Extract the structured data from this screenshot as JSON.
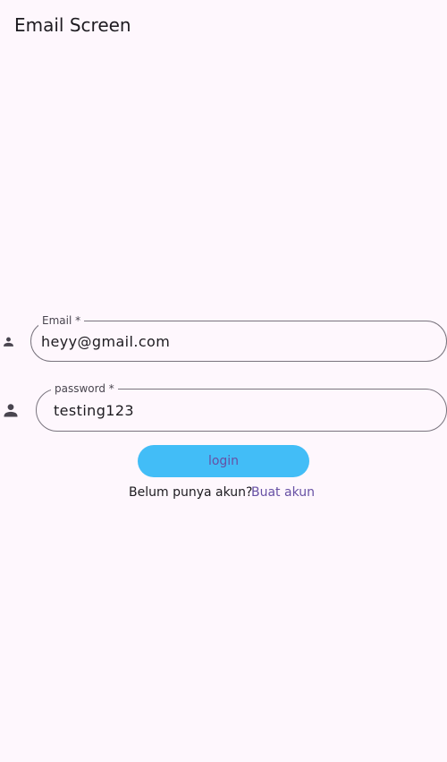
{
  "app_bar": {
    "title": "Email Screen"
  },
  "form": {
    "email": {
      "label": "Email *",
      "value": "heyy@gmail.com",
      "icon": "person-icon"
    },
    "password": {
      "label": "password *",
      "value": "testing123",
      "icon": "person-icon"
    },
    "login_label": "login",
    "signup_prompt": "Belum punya akun?",
    "signup_link": "Buat akun"
  },
  "colors": {
    "background": "#fef7fd",
    "button_fill": "#42bdf7",
    "accent": "#6750a4",
    "outline": "#79747e"
  }
}
